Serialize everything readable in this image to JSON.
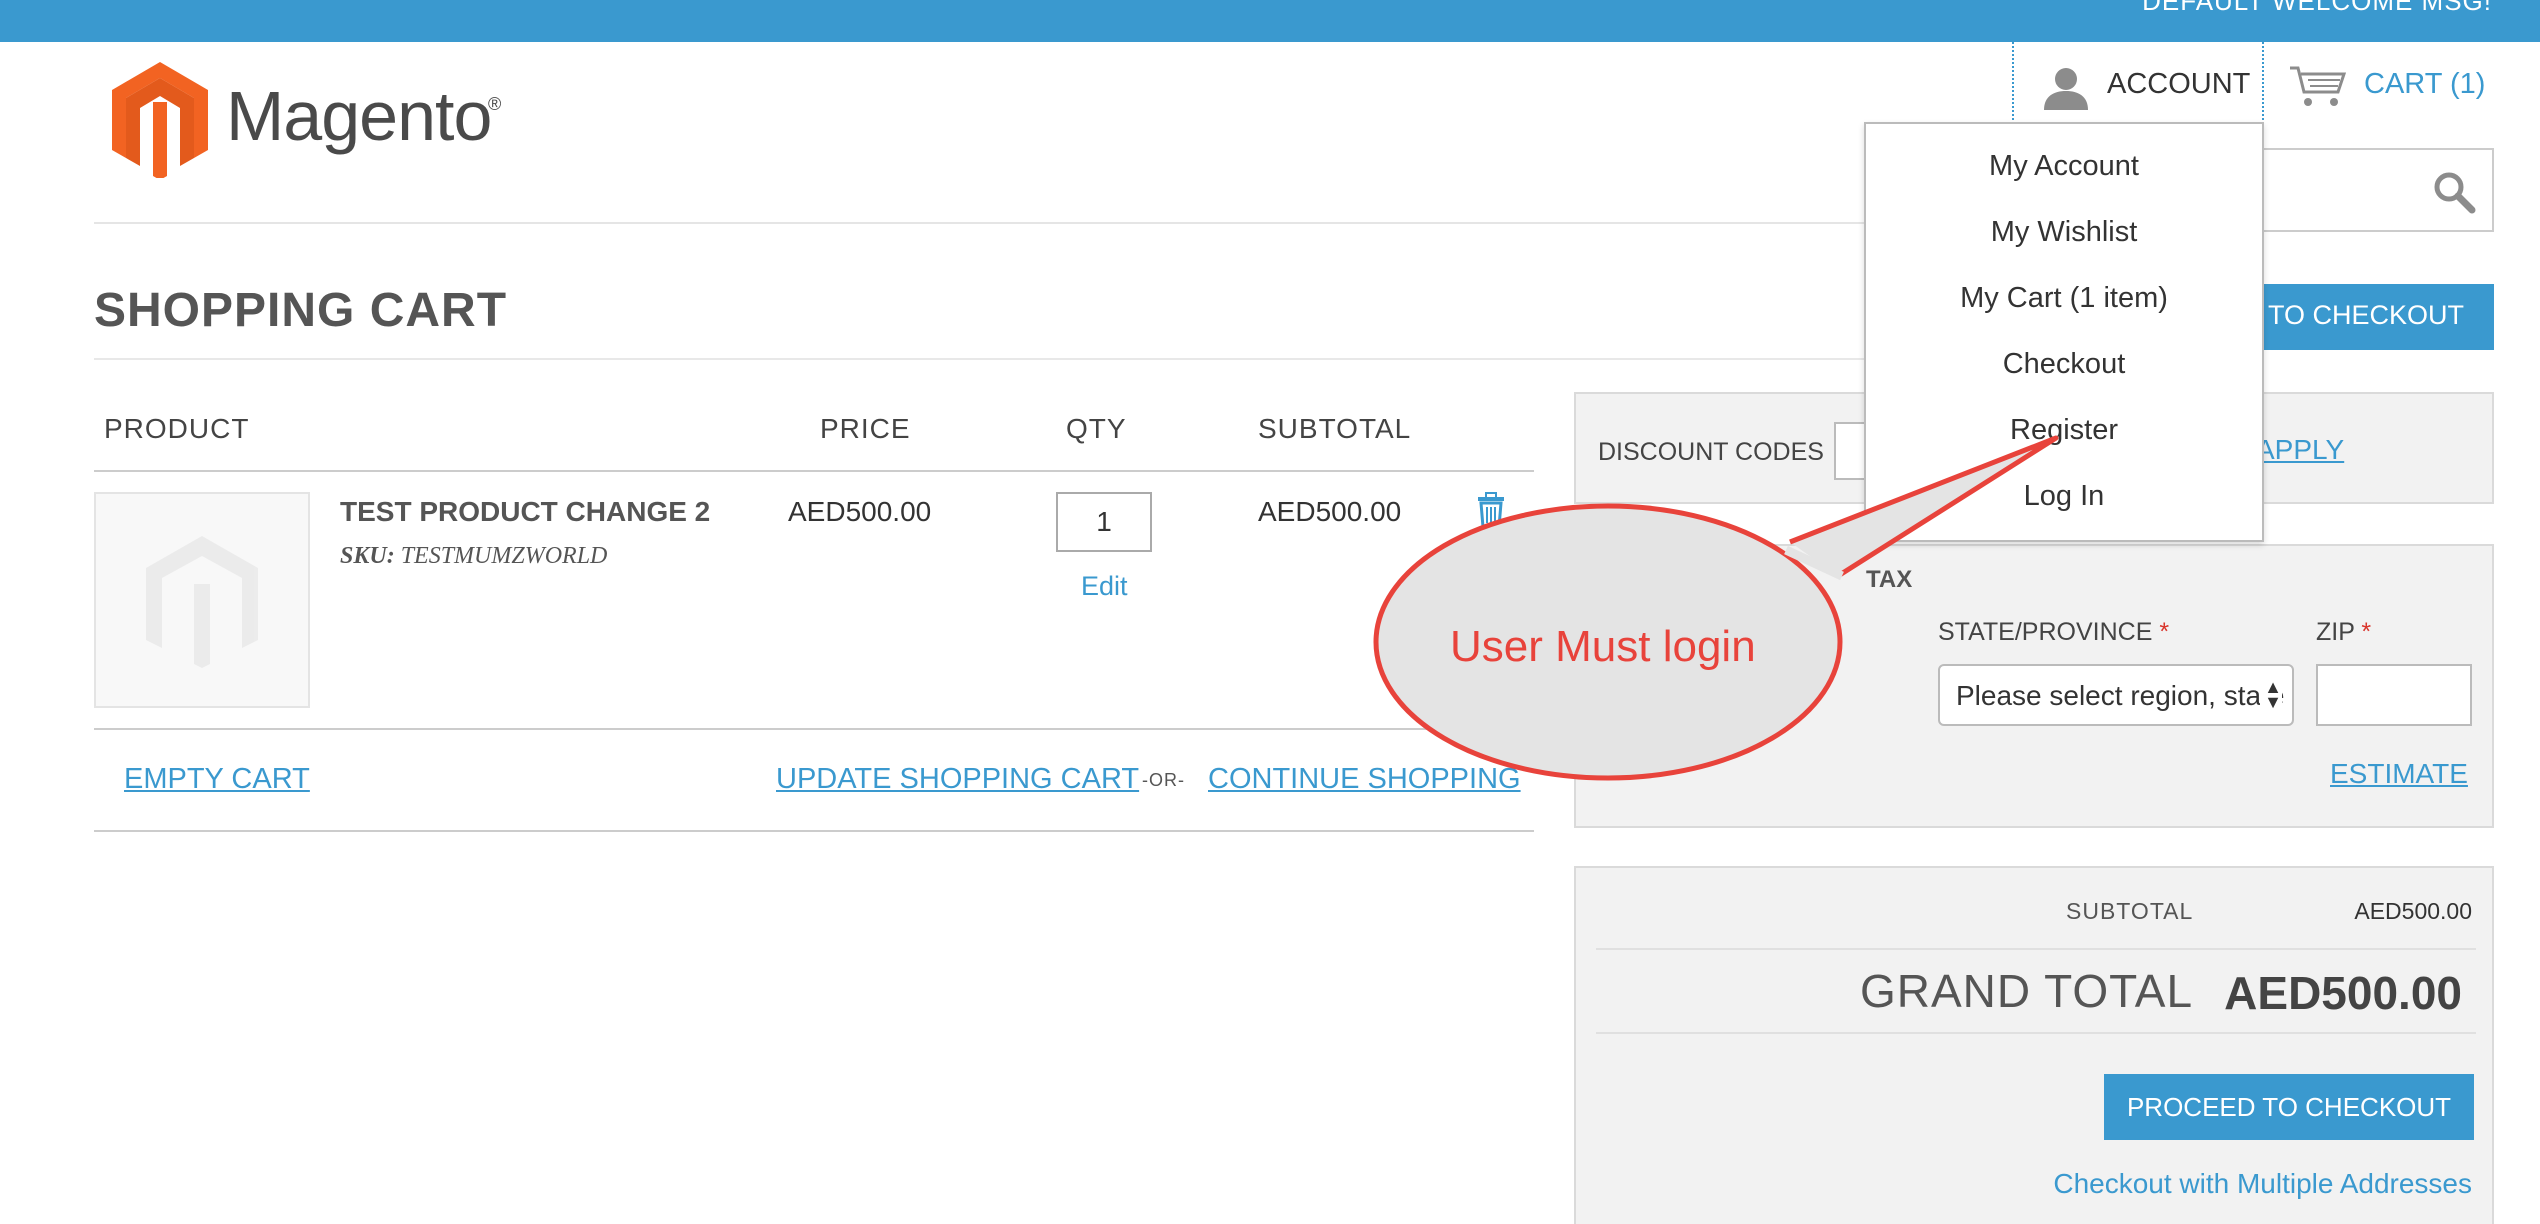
{
  "header": {
    "welcome": "DEFAULT WELCOME MSG!",
    "logo_text": "Magento",
    "logo_reg": "®",
    "account_label": "ACCOUNT",
    "cart_label": "CART (1)"
  },
  "account_menu": {
    "items": [
      "My Account",
      "My Wishlist",
      "My Cart (1 item)",
      "Checkout",
      "Register",
      "Log In"
    ]
  },
  "page": {
    "title": "SHOPPING CART",
    "checkout_top_label": "PROCEED TO CHECKOUT"
  },
  "cart_table": {
    "headers": [
      "PRODUCT",
      "PRICE",
      "QTY",
      "SUBTOTAL"
    ],
    "item": {
      "name": "TEST PRODUCT CHANGE 2",
      "sku_label": "SKU:",
      "sku": "TESTMUMZWORLD",
      "price": "AED500.00",
      "qty": "1",
      "edit": "Edit",
      "subtotal": "AED500.00"
    },
    "actions": {
      "empty": "EMPTY CART",
      "update": "UPDATE SHOPPING CART",
      "or": "-OR-",
      "continue": "CONTINUE SHOPPING"
    }
  },
  "discount": {
    "label": "DISCOUNT CODES",
    "apply": "APPLY"
  },
  "estimate": {
    "title": "TAX",
    "state_label": "STATE/PROVINCE",
    "zip_label": "ZIP",
    "required_mark": "*",
    "state_placeholder": "Please select region, state or province",
    "estimate_link": "ESTIMATE"
  },
  "totals": {
    "subtotal_label": "SUBTOTAL",
    "subtotal_value": "AED500.00",
    "grand_total_label": "GRAND TOTAL",
    "grand_total_value": "AED500.00",
    "proceed_label": "PROCEED TO CHECKOUT",
    "multi_address": "Checkout with Multiple Addresses"
  },
  "annotation": {
    "callout_text": "User Must login"
  },
  "colors": {
    "brand_blue": "#3a99cf",
    "logo_orange": "#f26322",
    "callout_red": "#e8433b"
  }
}
